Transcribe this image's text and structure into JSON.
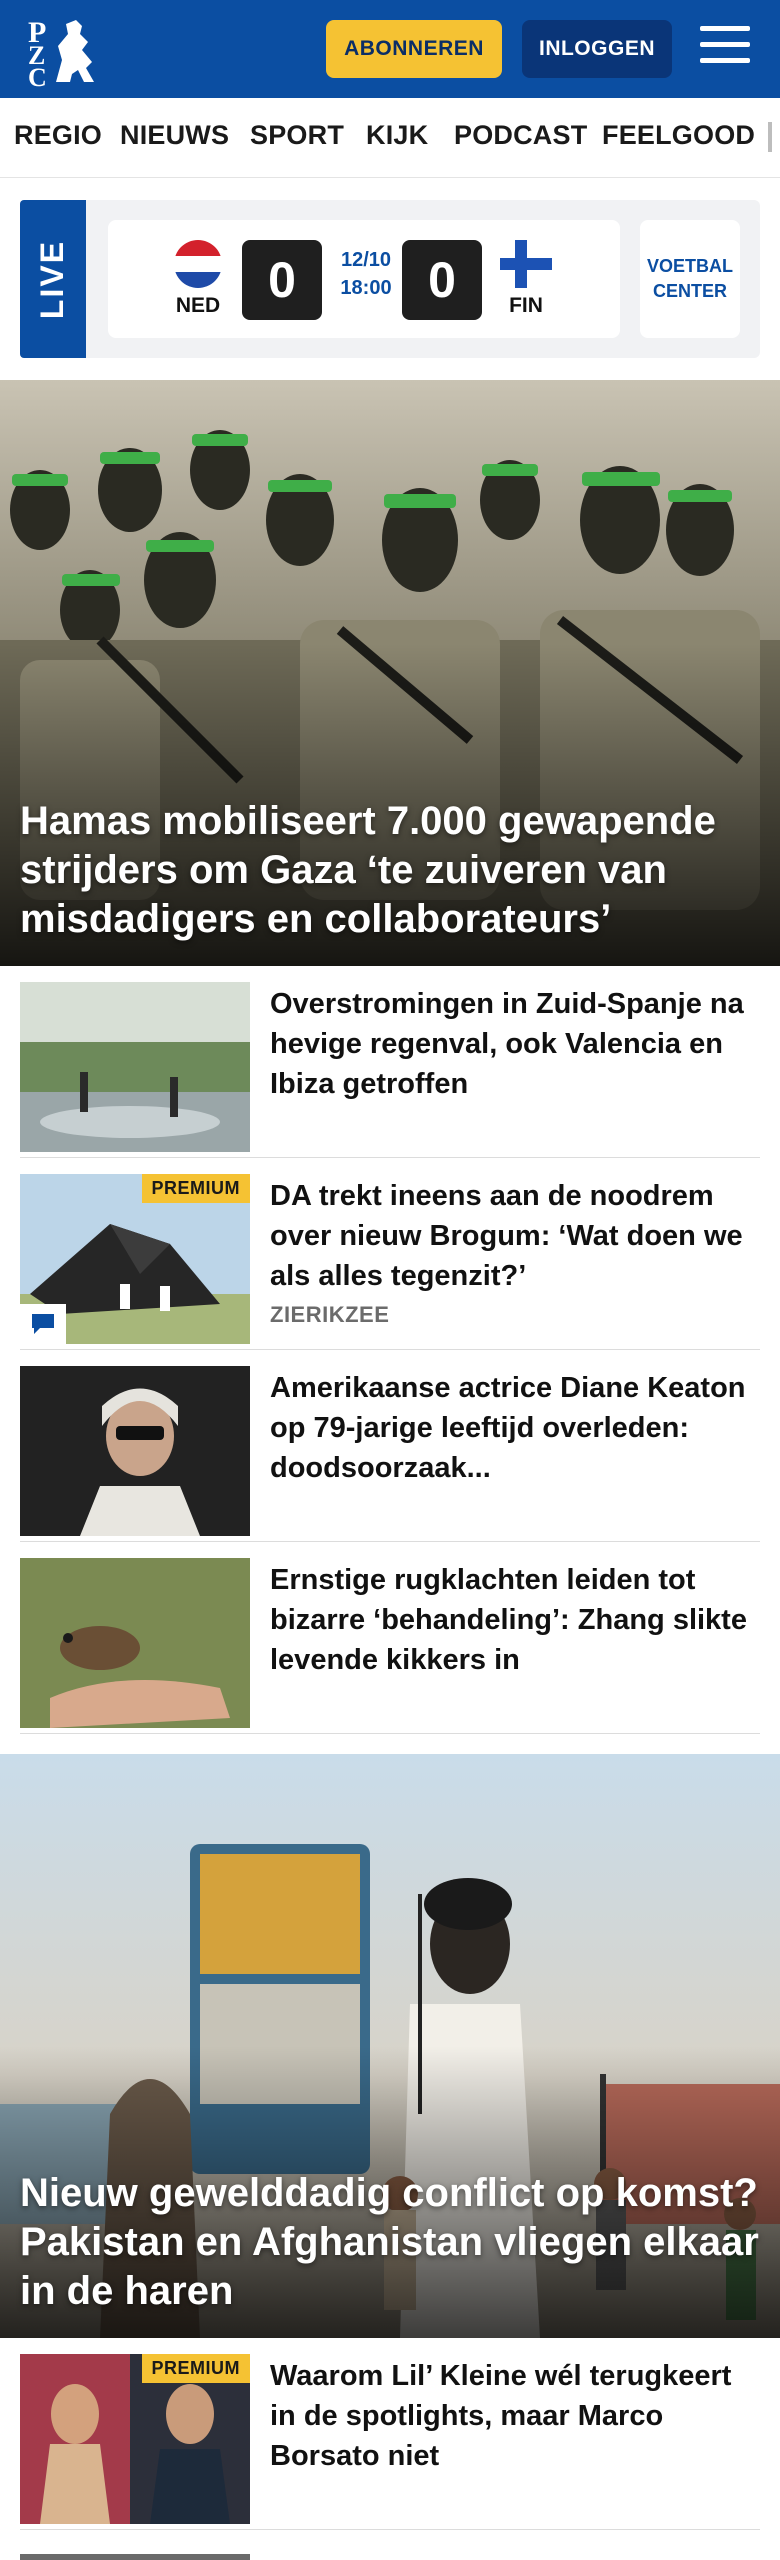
{
  "header": {
    "logo_letters": "PZC",
    "subscribe_label": "ABONNEREN",
    "login_label": "INLOGGEN",
    "menu_icon": "hamburger-icon",
    "brand_color": "#0b4ea2",
    "accent_color": "#f5c233"
  },
  "nav": {
    "items": [
      {
        "label": "REGIO"
      },
      {
        "label": "NIEUWS"
      },
      {
        "label": "SPORT"
      },
      {
        "label": "KIJK"
      },
      {
        "label": "PODCAST"
      },
      {
        "label": "FEELGOOD"
      }
    ]
  },
  "live": {
    "tag": "LIVE",
    "home_team": "NED",
    "away_team": "FIN",
    "home_score": "0",
    "away_score": "0",
    "date": "12/10",
    "time": "18:00",
    "voetbal_center_line1": "VOETBAL",
    "voetbal_center_line2": "CENTER"
  },
  "hero1": {
    "title": "Hamas mobiliseert 7.000 gewapende strijders om Gaza ‘te zuiveren van misdadigers en collaborateurs’"
  },
  "articles_a": [
    {
      "title": "Overstromingen in Zuid-Spanje na hevige regenval, ook Valencia en Ibiza getroffen"
    },
    {
      "title": "DA trekt ineens aan de noodrem over nieuw Brogum: ‘Wat doen we als alles tegenzit?’",
      "badge": "PREMIUM",
      "region": "ZIERIKZEE"
    },
    {
      "title": "Amerikaanse actrice Diane Keaton op 79-jarige leeftijd overleden: doodsoorzaak..."
    },
    {
      "title": "Ernstige rugklachten leiden tot bizarre ‘behandeling’: Zhang slikte levende kikkers in"
    }
  ],
  "hero2": {
    "title": "Nieuw gewelddadig conflict op komst? Pakistan en Afghanistan vliegen elkaar in de haren"
  },
  "articles_b": [
    {
      "title": "Waarom Lil’ Kleine wél terugkeert in de spotlights, maar Marco Borsato niet",
      "badge": "PREMIUM"
    }
  ]
}
